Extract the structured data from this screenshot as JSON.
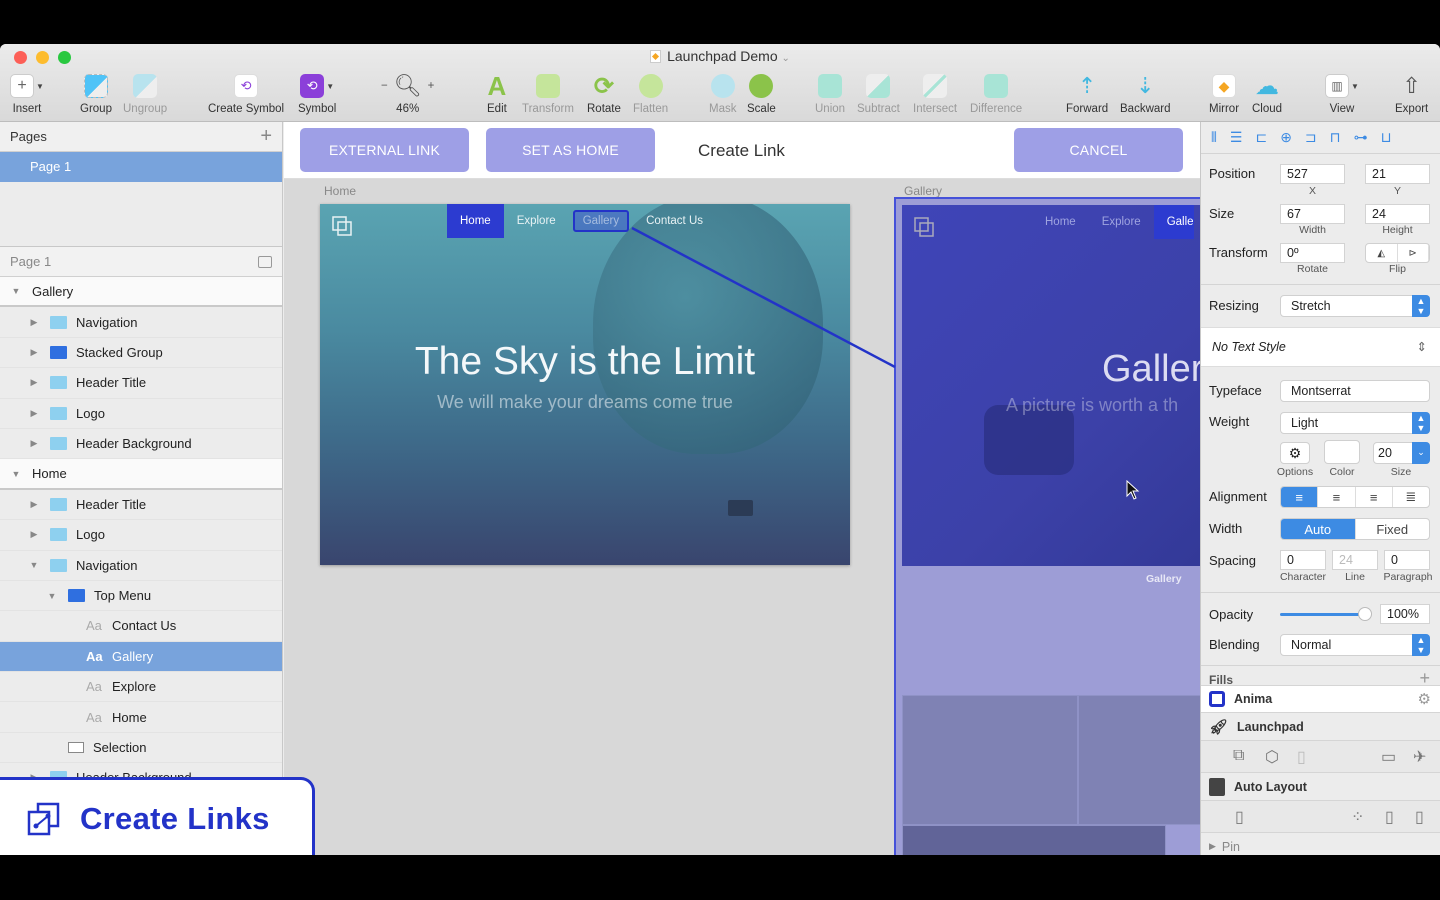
{
  "window": {
    "title": "Launchpad Demo"
  },
  "toolbar": [
    {
      "label": "Insert",
      "icon": "plus-icon",
      "dropdown": true,
      "enabled": true
    },
    {
      "label": "Group",
      "icon": "group-icon",
      "enabled": true
    },
    {
      "label": "Ungroup",
      "icon": "ungroup-icon",
      "enabled": false
    },
    {
      "label": "Create Symbol",
      "icon": "create-symbol-icon",
      "enabled": true
    },
    {
      "label": "Symbol",
      "icon": "symbol-icon",
      "dropdown": true,
      "enabled": true
    },
    {
      "label": "46%",
      "icon": "zoom-icon",
      "enabled": true
    },
    {
      "label": "Edit",
      "icon": "edit-icon",
      "enabled": true
    },
    {
      "label": "Transform",
      "icon": "transform-icon",
      "enabled": false
    },
    {
      "label": "Rotate",
      "icon": "rotate-icon",
      "enabled": true
    },
    {
      "label": "Flatten",
      "icon": "flatten-icon",
      "enabled": false
    },
    {
      "label": "Mask",
      "icon": "mask-icon",
      "enabled": false
    },
    {
      "label": "Scale",
      "icon": "scale-icon",
      "enabled": true
    },
    {
      "label": "Union",
      "icon": "union-icon",
      "enabled": false
    },
    {
      "label": "Subtract",
      "icon": "subtract-icon",
      "enabled": false
    },
    {
      "label": "Intersect",
      "icon": "intersect-icon",
      "enabled": false
    },
    {
      "label": "Difference",
      "icon": "difference-icon",
      "enabled": false
    },
    {
      "label": "Forward",
      "icon": "forward-icon",
      "enabled": true
    },
    {
      "label": "Backward",
      "icon": "backward-icon",
      "enabled": true
    },
    {
      "label": "Mirror",
      "icon": "mirror-icon",
      "enabled": true
    },
    {
      "label": "Cloud",
      "icon": "cloud-icon",
      "enabled": true
    },
    {
      "label": "View",
      "icon": "view-icon",
      "dropdown": true,
      "enabled": true
    },
    {
      "label": "Export",
      "icon": "export-icon",
      "enabled": true
    }
  ],
  "pages": {
    "header": "Pages",
    "items": [
      "Page 1"
    ],
    "selected": "Page 1",
    "current_page_label": "Page 1"
  },
  "layers": {
    "gallery": {
      "name": "Gallery",
      "children": [
        "Navigation",
        "Stacked Group",
        "Header Title",
        "Logo",
        "Header Background"
      ]
    },
    "home": {
      "name": "Home",
      "children": {
        "header_title": "Header Title",
        "logo": "Logo",
        "navigation": "Navigation",
        "top_menu": "Top Menu",
        "text_layers": [
          "Contact Us",
          "Gallery",
          "Explore",
          "Home"
        ],
        "selection": "Selection",
        "header_background": "Header Background"
      },
      "selected": "Gallery",
      "text_icon": "Aa"
    }
  },
  "overlay": {
    "label": "Create Links"
  },
  "link_bar": {
    "external_link": "EXTERNAL LINK",
    "set_as_home": "SET AS HOME",
    "title": "Create Link",
    "cancel": "CANCEL"
  },
  "artboards": {
    "home": {
      "name": "Home",
      "nav": [
        "Home",
        "Explore",
        "Gallery",
        "Contact Us"
      ],
      "active_nav": "Home",
      "title": "The Sky is the Limit",
      "subtitle": "We will make your dreams come true"
    },
    "gallery": {
      "name": "Gallery",
      "nav": [
        "Home",
        "Explore",
        "Galle"
      ],
      "title": "Galler",
      "subtitle": "A picture is worth a th",
      "section_label": "Gallery"
    }
  },
  "inspector": {
    "position": {
      "label": "Position",
      "x": "527",
      "y": "21",
      "x_label": "X",
      "y_label": "Y"
    },
    "size": {
      "label": "Size",
      "width": "67",
      "height": "24",
      "width_label": "Width",
      "height_label": "Height"
    },
    "transform": {
      "label": "Transform",
      "rotate": "0º",
      "rotate_label": "Rotate",
      "flip_label": "Flip"
    },
    "resizing": {
      "label": "Resizing",
      "value": "Stretch"
    },
    "text_style": "No Text Style",
    "typeface": {
      "label": "Typeface",
      "value": "Montserrat"
    },
    "weight": {
      "label": "Weight",
      "value": "Light"
    },
    "options_label": "Options",
    "color_label": "Color",
    "size_field": {
      "value": "20",
      "label": "Size"
    },
    "alignment": {
      "label": "Alignment",
      "selected": "left"
    },
    "width_mode": {
      "label": "Width",
      "options": [
        "Auto",
        "Fixed"
      ],
      "selected": "Auto"
    },
    "spacing": {
      "label": "Spacing",
      "character": "0",
      "line": "24",
      "paragraph": "0",
      "character_label": "Character",
      "line_label": "Line",
      "paragraph_label": "Paragraph"
    },
    "opacity": {
      "label": "Opacity",
      "value": "100%",
      "fraction": 1.0
    },
    "blending": {
      "label": "Blending",
      "value": "Normal"
    },
    "fills_label": "Fills",
    "plugins": {
      "anima": "Anima",
      "launchpad": "Launchpad",
      "auto_layout": "Auto Layout",
      "pin": "Pin"
    }
  },
  "colors": {
    "accent": "#3d8be3",
    "link_blue": "#2333c8",
    "selection": "#78a3dc",
    "link_button": "#9e9fe6"
  }
}
